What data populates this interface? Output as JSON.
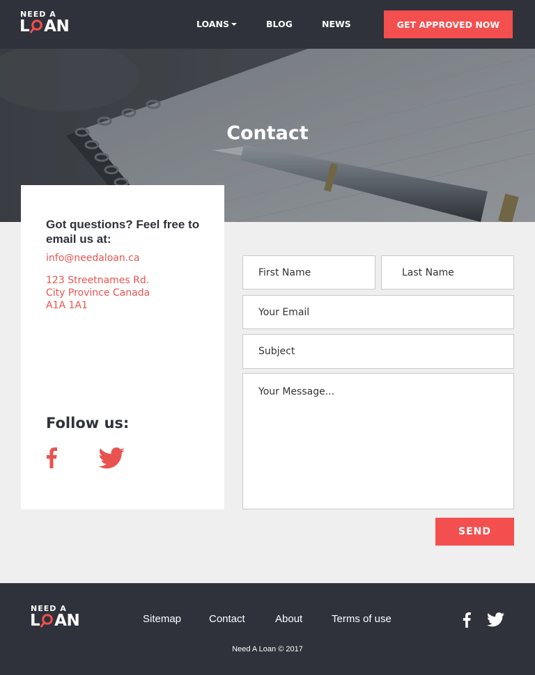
{
  "colors": {
    "accent": "#f44f4f",
    "dark": "#2f323a",
    "link": "#e9534f",
    "background": "#efefef"
  },
  "brand": {
    "logo_top": "NEED A",
    "logo_bottom_l": "L",
    "logo_bottom_rest": "AN"
  },
  "nav": {
    "items": [
      {
        "label": "LOANS",
        "has_dropdown": true
      },
      {
        "label": "BLOG"
      },
      {
        "label": "NEWS"
      }
    ],
    "cta_label": "GET APPROVED NOW"
  },
  "hero": {
    "title": "Contact"
  },
  "info": {
    "heading": "Got questions? Feel free to email us at:",
    "email": "info@needaloan.ca",
    "address_line1": "123 Streetnames Rd.",
    "address_line2": "City Province Canada",
    "address_line3": "A1A 1A1",
    "follow_heading": "Follow us:",
    "social_icons": [
      "facebook-icon",
      "twitter-icon"
    ]
  },
  "form": {
    "first_name_placeholder": "First Name",
    "last_name_placeholder": "Last Name",
    "email_placeholder": "Your Email",
    "subject_placeholder": "Subject",
    "message_placeholder": "Your Message...",
    "send_label": "SEND"
  },
  "footer": {
    "links": [
      "Sitemap",
      "Contact",
      "About",
      "Terms of use"
    ],
    "copyright": "Need A Loan © 2017"
  }
}
